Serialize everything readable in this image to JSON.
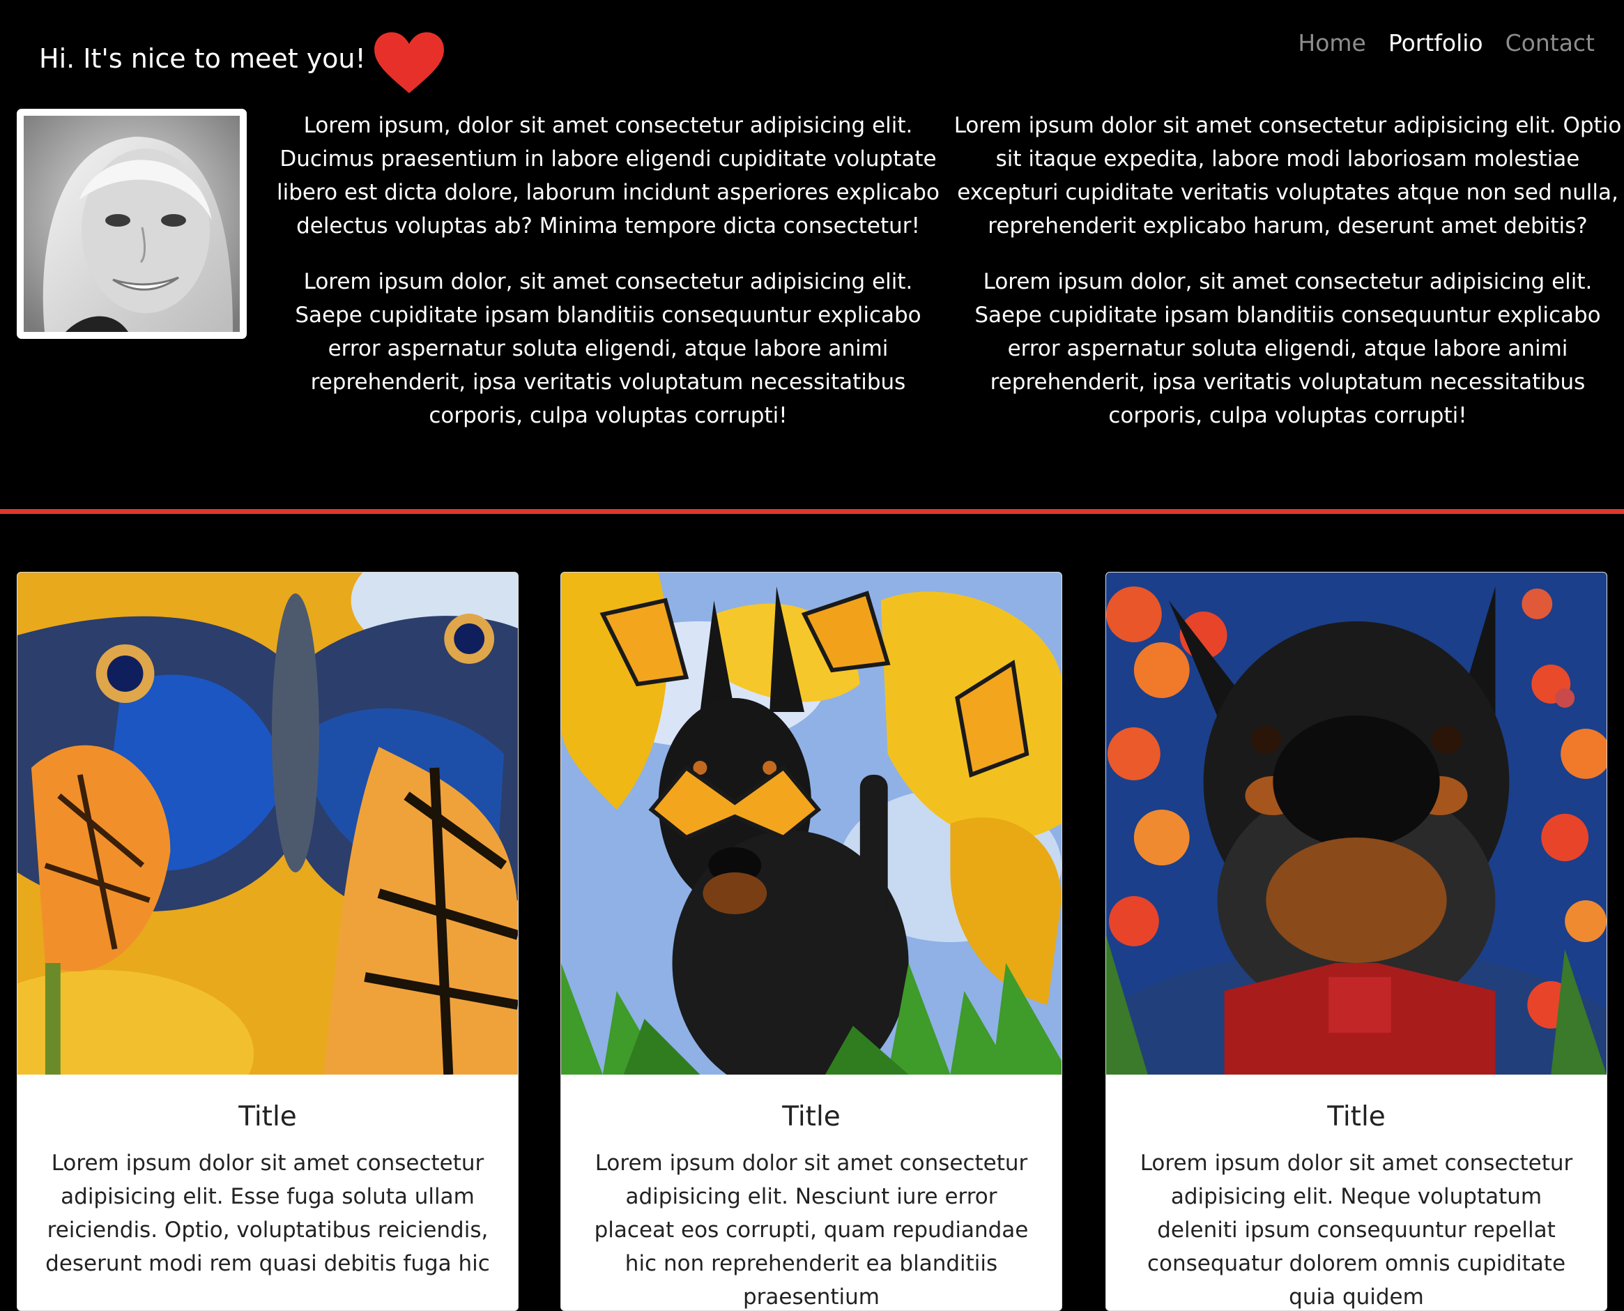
{
  "navbar": {
    "brand_text": "Hi. It's nice to meet you!",
    "heart_icon": "heart-icon",
    "heart_color": "#e8302a",
    "links": [
      {
        "label": "Home",
        "active": false
      },
      {
        "label": "Portfolio",
        "active": true
      },
      {
        "label": "Contact",
        "active": false
      }
    ]
  },
  "about": {
    "profile_image": "profile-photo",
    "column1": [
      "Lorem ipsum, dolor sit amet consectetur adipisicing elit. Ducimus praesentium in labore eligendi cupiditate voluptate libero est dicta dolore, laborum incidunt asperiores explicabo delectus voluptas ab? Minima tempore dicta consectetur!",
      "Lorem ipsum dolor, sit amet consectetur adipisicing elit. Saepe cupiditate ipsam blanditiis consequuntur explicabo error aspernatur soluta eligendi, atque labore animi reprehenderit, ipsa veritatis voluptatum necessitatibus corporis, culpa voluptas corrupti!"
    ],
    "column2": [
      "Lorem ipsum dolor sit amet consectetur adipisicing elit. Optio sit itaque expedita, labore modi laboriosam molestiae excepturi cupiditate veritatis voluptates atque non sed nulla, reprehenderit explicabo harum, deserunt amet debitis?",
      "Lorem ipsum dolor, sit amet consectetur adipisicing elit. Saepe cupiditate ipsam blanditiis consequuntur explicabo error aspernatur soluta eligendi, atque labore animi reprehenderit, ipsa veritatis voluptatum necessitatibus corporis, culpa voluptas corrupti!"
    ]
  },
  "divider_color": "#e0362c",
  "cards": [
    {
      "image": "butterflies-image",
      "title": "Title",
      "text": "Lorem ipsum dolor sit amet consectetur adipisicing elit. Esse fuga soluta ullam reiciendis. Optio, voluptatibus reiciendis, deserunt modi rem quasi debitis fuga hic"
    },
    {
      "image": "dog-butterflies-image",
      "title": "Title",
      "text": "Lorem ipsum dolor sit amet consectetur adipisicing elit. Nesciunt iure error placeat eos corrupti, quam repudiandae hic non reprehenderit ea blanditiis praesentium"
    },
    {
      "image": "dog-bowtie-image",
      "title": "Title",
      "text": "Lorem ipsum dolor sit amet consectetur adipisicing elit. Neque voluptatum deleniti ipsum consequuntur repellat consequatur dolorem omnis cupiditate quia quidem"
    }
  ]
}
